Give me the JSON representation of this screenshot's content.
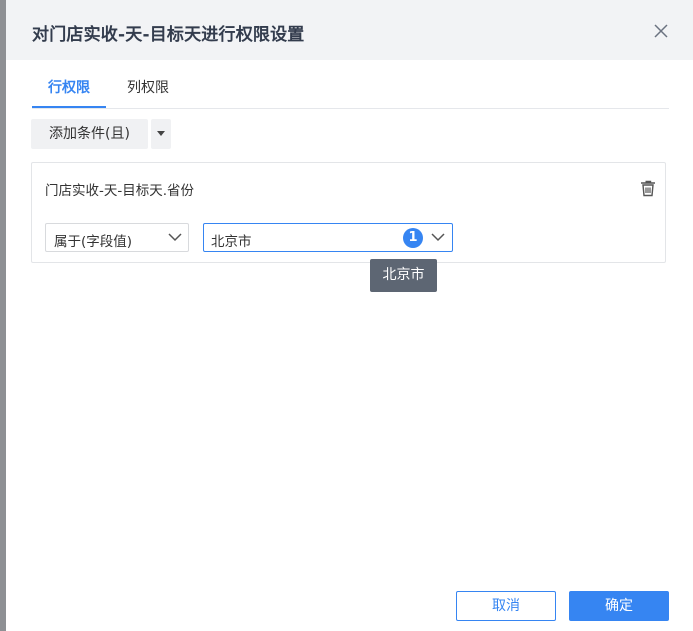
{
  "dialog": {
    "title": "对门店实收-天-目标天进行权限设置",
    "close_icon": "close-icon"
  },
  "tabs": [
    {
      "label": "行权限",
      "active": true
    },
    {
      "label": "列权限",
      "active": false
    }
  ],
  "toolbar": {
    "add_condition_label": "添加条件(且)",
    "caret_icon": "caret-down-icon"
  },
  "condition": {
    "field": "门店实收-天-目标天.省份",
    "operator": "属于(字段值)",
    "value": "北京市",
    "selected_count": "1",
    "delete_icon": "trash-icon"
  },
  "tooltip": {
    "text": "北京市"
  },
  "footer": {
    "cancel_label": "取消",
    "confirm_label": "确定"
  },
  "colors": {
    "accent": "#3685f2",
    "header_bg": "#f2f3f5",
    "tooltip_bg": "#5d6673"
  }
}
